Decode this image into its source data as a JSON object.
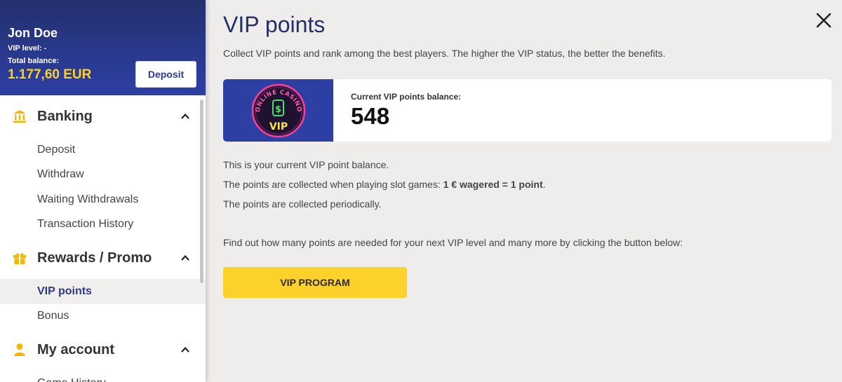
{
  "user": {
    "name": "Jon Doe",
    "vip_level_label": "VIP level: -",
    "total_balance_label": "Total balance:",
    "total_balance_value": "1.177,60 EUR",
    "deposit_label": "Deposit"
  },
  "sidebar": {
    "sections": [
      {
        "label": "Banking",
        "icon": "bank-icon",
        "items": [
          "Deposit",
          "Withdraw",
          "Waiting Withdrawals",
          "Transaction History"
        ]
      },
      {
        "label": "Rewards / Promo",
        "icon": "gift-icon",
        "items": [
          "VIP points",
          "Bonus"
        ]
      },
      {
        "label": "My account",
        "icon": "user-icon",
        "items": [
          "Game History"
        ]
      }
    ],
    "active_item": "VIP points"
  },
  "main": {
    "title": "VIP points",
    "subtitle": "Collect VIP points and rank among the best players. The higher the VIP status, the better the benefits.",
    "card": {
      "badge_top_text": "ONLINE CASINO",
      "badge_text": "VIP",
      "label": "Current VIP points balance:",
      "value": "548"
    },
    "info": {
      "line1": "This is your current VIP point balance.",
      "line2_prefix": "The points are collected when playing slot games: ",
      "line2_bold": "1 € wagered = 1 point",
      "line2_suffix": ".",
      "line3": "The points are collected periodically.",
      "cta": "Find out how many points are needed for your next VIP level and many more by clicking the button below:"
    },
    "button_label": "VIP PROGRAM"
  },
  "colors": {
    "brand_blue": "#2d3fa3",
    "accent_yellow": "#fcd12a",
    "title_blue": "#232e6b",
    "neon_pink": "#ff3d9a"
  }
}
